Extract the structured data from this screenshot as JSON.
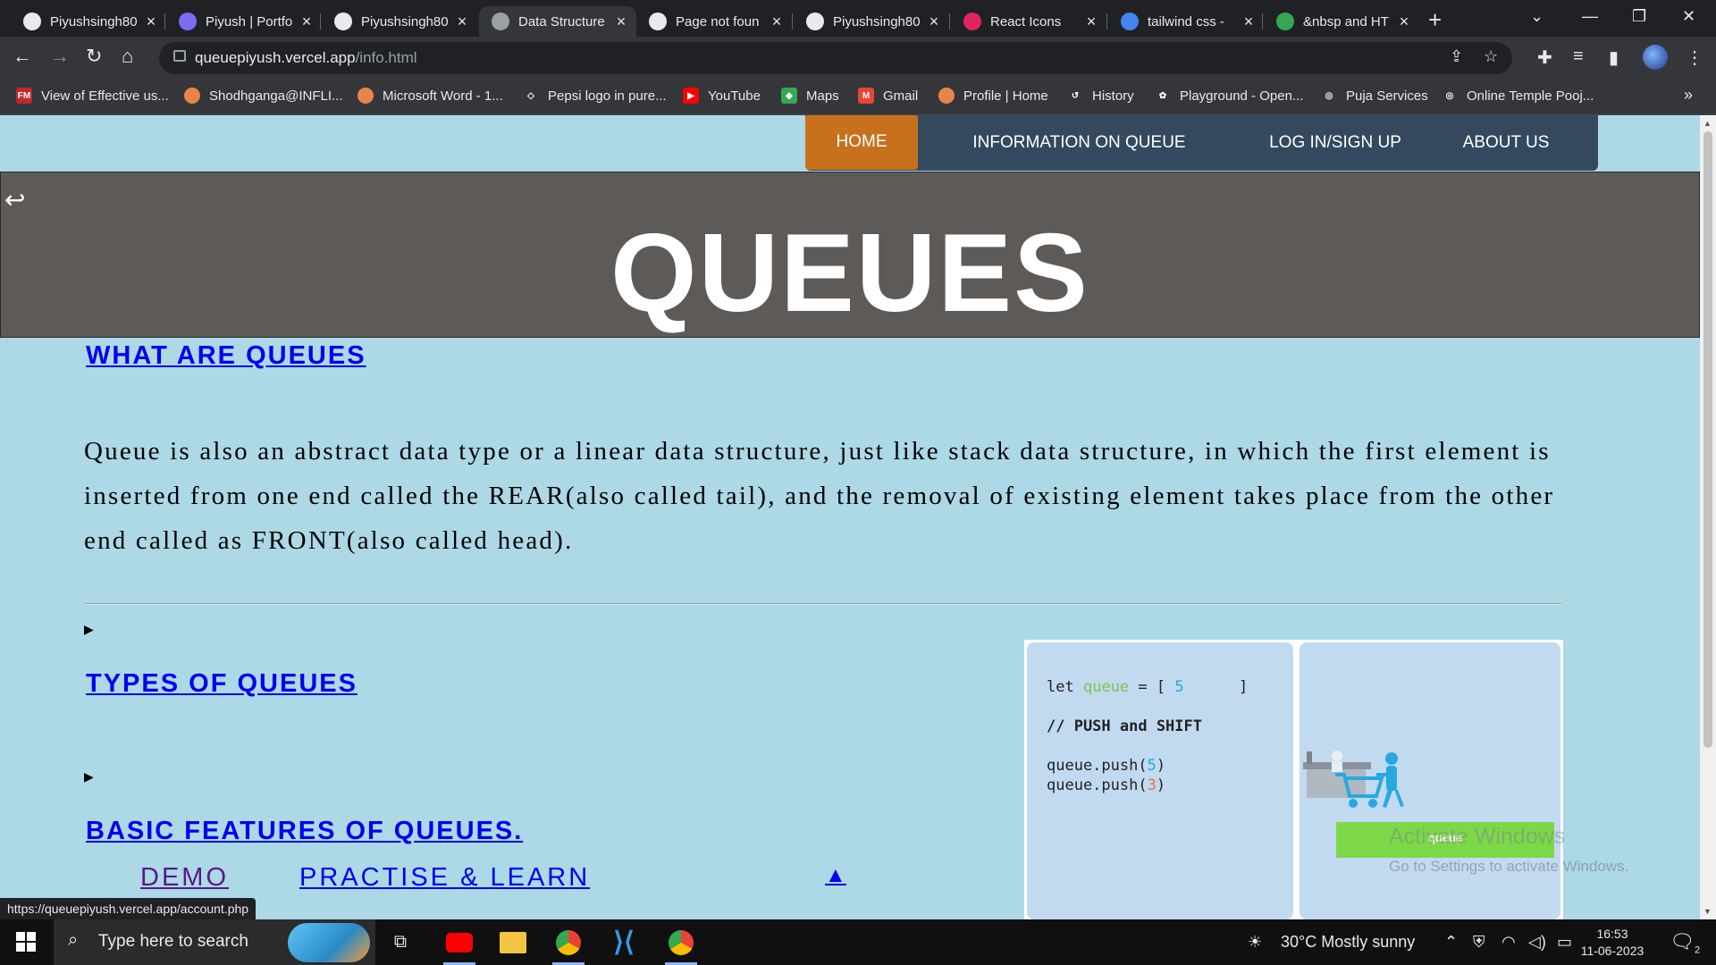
{
  "browser": {
    "tabs": [
      {
        "title": "Piyushsingh80",
        "icon": "github-icon",
        "active": false
      },
      {
        "title": "Piyush | Portfo",
        "icon": "portfolio-icon",
        "active": false
      },
      {
        "title": "Piyushsingh80",
        "icon": "github-icon",
        "active": false
      },
      {
        "title": "Data Structure",
        "icon": "globe-icon",
        "active": true
      },
      {
        "title": "Page not foun",
        "icon": "github-icon",
        "active": false
      },
      {
        "title": "Piyushsingh80",
        "icon": "github-icon",
        "active": false
      },
      {
        "title": "React Icons",
        "icon": "react-icon",
        "active": false
      },
      {
        "title": "tailwind css -",
        "icon": "google-icon",
        "active": false
      },
      {
        "title": "&nbsp and HT",
        "icon": "gmail-like-icon",
        "active": false
      }
    ],
    "new_tab_label": "+",
    "url_host": "queuepiyush.vercel.app",
    "url_path": "/info.html",
    "bookmarks": [
      {
        "label": "View of Effective us...",
        "icon": "fm-icon",
        "color": "#c0282d",
        "glyph": "FM"
      },
      {
        "label": "Shodhganga@INFLI...",
        "icon": "shodhganga-icon",
        "color": "#e8844a",
        "glyph": ""
      },
      {
        "label": "Microsoft Word - 1...",
        "icon": "doc-icon",
        "color": "#e8844a",
        "glyph": ""
      },
      {
        "label": "Pepsi logo in pure...",
        "icon": "codepen-icon",
        "color": "#35363a",
        "glyph": "◇"
      },
      {
        "label": "YouTube",
        "icon": "youtube-icon",
        "color": "#ff0000",
        "glyph": "▶"
      },
      {
        "label": "Maps",
        "icon": "maps-icon",
        "color": "#34a853",
        "glyph": "◆"
      },
      {
        "label": "Gmail",
        "icon": "gmail-icon",
        "color": "#ea4335",
        "glyph": "M"
      },
      {
        "label": "Profile | Home",
        "icon": "profile-icon",
        "color": "#e8844a",
        "glyph": ""
      },
      {
        "label": "History",
        "icon": "history-icon",
        "color": "#35363a",
        "glyph": "↺"
      },
      {
        "label": "Playground - Open...",
        "icon": "openai-icon",
        "color": "#35363a",
        "glyph": "✿"
      },
      {
        "label": "Puja Services",
        "icon": "globe-icon",
        "color": "#35363a",
        "glyph": "◎"
      },
      {
        "label": "Online Temple Pooj...",
        "icon": "globe-icon",
        "color": "#35363a",
        "glyph": "◎"
      }
    ],
    "status_url": "https://queuepiyush.vercel.app/account.php"
  },
  "page": {
    "nav": [
      "HOME",
      "INFORMATION ON QUEUE",
      "LOG IN/SIGN UP",
      "ABOUT US"
    ],
    "hero_title": "QUEUES",
    "what_heading": "WHAT ARE QUEUES",
    "what_text": "Queue is also an abstract data type or a linear data structure, just like stack data structure, in which the first element is inserted from one end called the REAR(also called tail), and the removal of existing element takes place from the other end called as FRONT(also called head).",
    "disclosure_marker": "▶",
    "types_heading": "TYPES OF QUEUES",
    "features_heading": "BASIC FEATURES OF QUEUES.",
    "demo_link": "DEMO",
    "practise_link": "PRACTISE & LEARN",
    "up_arrow": "▲",
    "code": {
      "let": "let",
      "var": "queue",
      "eq_open": " = [ ",
      "value": "5",
      "close": "]",
      "comment": "// PUSH and SHIFT",
      "push1_pre": "queue.push(",
      "push1_val": "5",
      "push2_pre": "queue.push(",
      "push2_val": "3",
      "paren": ")"
    },
    "queue_button": "queue",
    "watermark_line1": "Activate Windows",
    "watermark_line2": "Go to Settings to activate Windows."
  },
  "taskbar": {
    "search_placeholder": "Type here to search",
    "weather": "30°C  Mostly sunny",
    "time": "16:53",
    "date": "11-06-2023",
    "notification_count": "2"
  },
  "colors": {
    "page_bg": "#add8e6",
    "nav_bg": "#34495e",
    "nav_home": "#c7711c",
    "hero_bg": "#5d5a58",
    "link": "#0000ee",
    "visited": "#551a8b",
    "queue_button": "#7dd848"
  }
}
